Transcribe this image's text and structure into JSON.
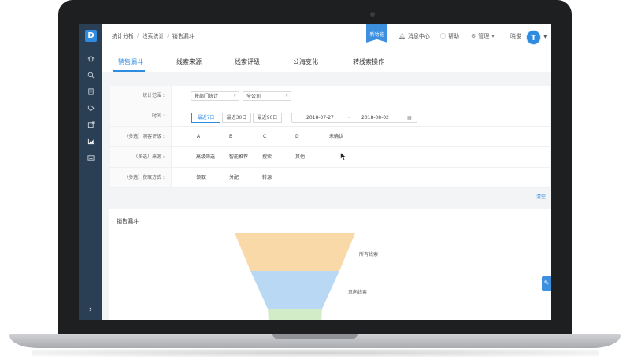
{
  "breadcrumb": [
    "统计分析",
    "线索统计",
    "销售漏斗"
  ],
  "header": {
    "new_badge": "新功能",
    "messages": "消息中心",
    "help": "帮助",
    "manage": "管理",
    "user": "晓俊",
    "avatar_letter": "T"
  },
  "tabs": [
    "销售漏斗",
    "线索来源",
    "线索评级",
    "公海变化",
    "转线索操作"
  ],
  "filter": {
    "scope_label": "统计范围 :",
    "scope_select": "按部门统计",
    "company_select": "全公司",
    "time_label": "时间 :",
    "time_buttons": [
      "最近7日",
      "最近30日",
      "最近90日"
    ],
    "date_start": "2018-07-27",
    "date_sep": "~",
    "date_end": "2018-08-02",
    "rating_label": "（多选）洞客评级 :",
    "rating_options": [
      "A",
      "B",
      "C",
      "D",
      "未确认"
    ],
    "source_label": "（多选）来源 :",
    "source_options": [
      "高级筛选",
      "智能推荐",
      "搜索",
      "其他"
    ],
    "acquire_label": "（多选）获取方式 :",
    "acquire_options": [
      "领取",
      "分配",
      "转源"
    ],
    "clear": "清空"
  },
  "chart": {
    "title": "销售漏斗"
  },
  "chart_data": {
    "type": "funnel",
    "stages": [
      {
        "name": "所有线索",
        "color": "#f9d9a8"
      },
      {
        "name": "意向线索",
        "color": "#b9d8f4"
      },
      {
        "name": "",
        "color": "#d3ecc8"
      }
    ]
  },
  "sidebar": {
    "icons": [
      "home-icon",
      "search-icon",
      "document-icon",
      "tag-icon",
      "export-icon",
      "chart-icon",
      "list-icon"
    ],
    "expand": "›"
  },
  "colors": {
    "accent": "#2d8ce0",
    "sidebar": "#2a3f54"
  }
}
